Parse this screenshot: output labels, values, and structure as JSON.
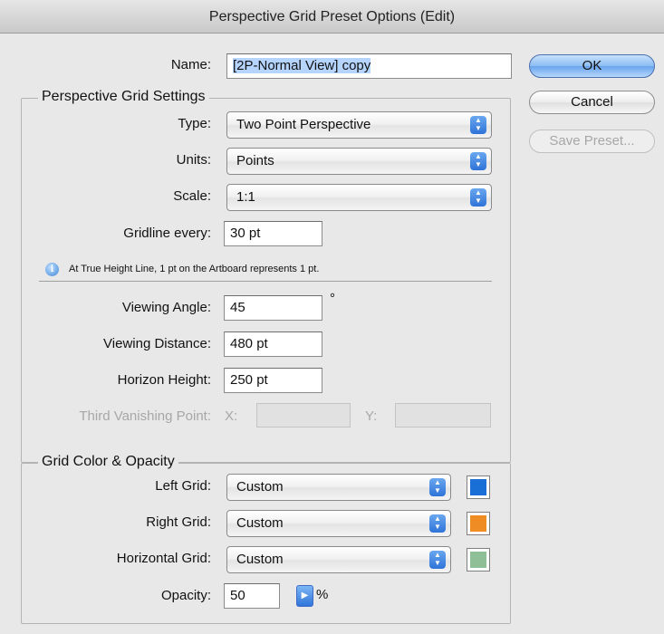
{
  "window": {
    "title": "Perspective Grid Preset Options (Edit)"
  },
  "name": {
    "label": "Name:",
    "value": "[2P-Normal View] copy"
  },
  "buttons": {
    "ok": "OK",
    "cancel": "Cancel",
    "save_preset": "Save Preset..."
  },
  "settings": {
    "title": "Perspective Grid Settings",
    "type_label": "Type:",
    "type_value": "Two Point Perspective",
    "units_label": "Units:",
    "units_value": "Points",
    "scale_label": "Scale:",
    "scale_value": "1:1",
    "gridline_label": "Gridline every:",
    "gridline_value": "30 pt",
    "info_text": "At True Height Line, 1 pt on the Artboard represents 1 pt.",
    "viewing_angle_label": "Viewing Angle:",
    "viewing_angle_value": "45",
    "degree_symbol": "°",
    "viewing_distance_label": "Viewing Distance:",
    "viewing_distance_value": "480 pt",
    "horizon_height_label": "Horizon Height:",
    "horizon_height_value": "250 pt",
    "third_vp_label": "Third Vanishing Point:",
    "x_label": "X:",
    "y_label": "Y:"
  },
  "grid_color": {
    "title": "Grid Color & Opacity",
    "left_label": "Left Grid:",
    "left_value": "Custom",
    "left_color": "#1a6fd6",
    "right_label": "Right Grid:",
    "right_value": "Custom",
    "right_color": "#f08c24",
    "horizontal_label": "Horizontal Grid:",
    "horizontal_value": "Custom",
    "horizontal_color": "#8fbf96",
    "opacity_label": "Opacity:",
    "opacity_value": "50",
    "opacity_unit": "%"
  },
  "icons": {
    "info": "info-icon",
    "popup_arrows": "chevron-updown-icon",
    "stepper": "triangle-right-icon"
  }
}
